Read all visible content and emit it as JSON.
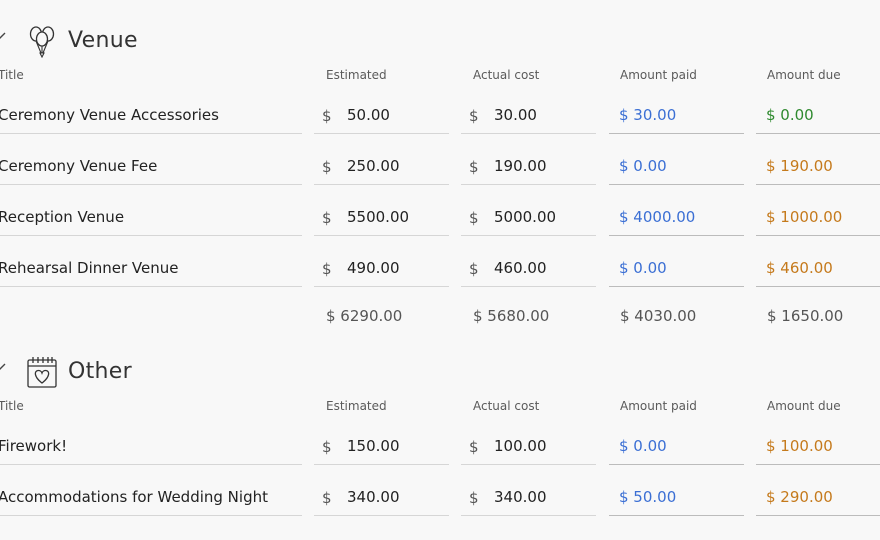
{
  "columns": {
    "title": "Title",
    "estimated": "Estimated",
    "actual": "Actual cost",
    "paid": "Amount paid",
    "due": "Amount due"
  },
  "currency": "$",
  "colors": {
    "paid": "#3b6fd4",
    "due_zero": "#2f8a2f",
    "due_open": "#c57a1c"
  },
  "sections": {
    "venue": {
      "name": "Venue",
      "icon": "balloons-icon",
      "rows": [
        {
          "title": "Ceremony Venue Accessories",
          "estimated": "50.00",
          "actual": "30.00",
          "paid": "$ 30.00",
          "due": "$ 0.00"
        },
        {
          "title": "Ceremony Venue Fee",
          "estimated": "250.00",
          "actual": "190.00",
          "paid": "$ 0.00",
          "due": "$ 190.00"
        },
        {
          "title": "Reception Venue",
          "estimated": "5500.00",
          "actual": "5000.00",
          "paid": "$ 4000.00",
          "due": "$ 1000.00"
        },
        {
          "title": "Rehearsal Dinner Venue",
          "estimated": "490.00",
          "actual": "460.00",
          "paid": "$ 0.00",
          "due": "$ 460.00"
        }
      ],
      "totals": {
        "estimated": "$ 6290.00",
        "actual": "$ 5680.00",
        "paid": "$ 4030.00",
        "due": "$ 1650.00"
      }
    },
    "other": {
      "name": "Other",
      "icon": "calendar-heart-icon",
      "rows": [
        {
          "title": "Firework!",
          "estimated": "150.00",
          "actual": "100.00",
          "paid": "$ 0.00",
          "due": "$ 100.00"
        },
        {
          "title": "Accommodations for Wedding Night",
          "estimated": "340.00",
          "actual": "340.00",
          "paid": "$ 50.00",
          "due": "$ 290.00"
        }
      ]
    }
  }
}
